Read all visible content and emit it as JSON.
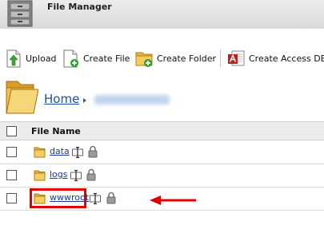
{
  "window": {
    "title": "File Manager"
  },
  "toolbar": {
    "upload_label": "Upload",
    "create_file_label": "Create File",
    "create_folder_label": "Create Folder",
    "create_access_db_label": "Create Access DB"
  },
  "breadcrumb": {
    "home_label": "Home"
  },
  "table": {
    "header": "File Name",
    "rows": [
      {
        "name": "data"
      },
      {
        "name": "logs"
      },
      {
        "name": "wwwroot"
      }
    ]
  },
  "colors": {
    "link": "#1a3e8c",
    "highlight": "#e00000",
    "folder": "#e9b43a"
  }
}
